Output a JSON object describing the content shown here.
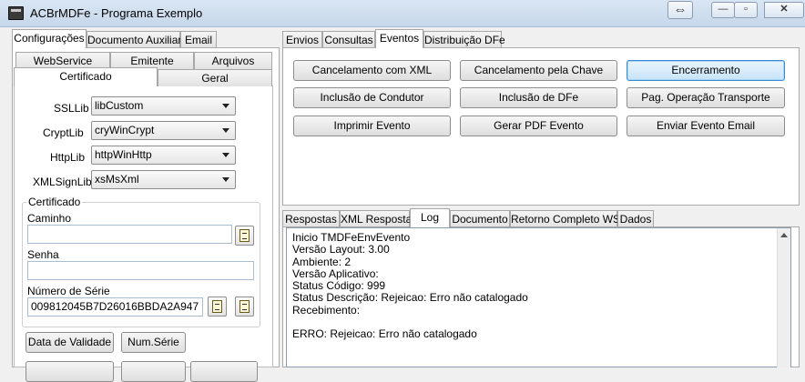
{
  "window": {
    "title": "ACBrMDFe - Programa Exemplo"
  },
  "left_tabs": [
    "Configurações",
    "Documento Auxiliar",
    "Email"
  ],
  "sub_tabs_row1": [
    "WebService",
    "Emitente",
    "Arquivos"
  ],
  "sub_tabs_row2": [
    "Certificado",
    "Geral"
  ],
  "libs": {
    "ssl_label": "SSLLib",
    "ssl_value": "libCustom",
    "crypt_label": "CryptLib",
    "crypt_value": "cryWinCrypt",
    "http_label": "HttpLib",
    "http_value": "httpWinHttp",
    "xmlsign_label": "XMLSignLib",
    "xmlsign_value": "xsMsXml"
  },
  "certificado": {
    "group_label": "Certificado",
    "caminho_label": "Caminho",
    "caminho_value": "",
    "senha_label": "Senha",
    "senha_value": "",
    "serie_label": "Número de Série",
    "serie_value": "009812045B7D26016BBDA2A947"
  },
  "cert_buttons": {
    "data_validade": "Data de Validade",
    "num_serie": "Num.Série"
  },
  "right_tabs": [
    "Envios",
    "Consultas",
    "Eventos",
    "Distribuição DFe"
  ],
  "event_buttons": [
    "Cancelamento com XML",
    "Cancelamento pela Chave",
    "Encerramento",
    "Inclusão de Condutor",
    "Inclusão de DFe",
    "Pag. Operação Transporte",
    "Imprimir Evento",
    "Gerar PDF Evento",
    "Enviar Evento Email"
  ],
  "result_tabs": [
    "Respostas",
    "XML Resposta",
    "Log",
    "Documento",
    "Retorno Completo WS",
    "Dados"
  ],
  "log_lines": [
    "Inicio TMDFeEnvEvento",
    "Versão Layout: 3.00",
    "Ambiente: 2",
    "Versão Aplicativo:",
    "Status Código: 999",
    "Status Descrição: Rejeicao: Erro não catalogado",
    "Recebimento:",
    "",
    "ERRO: Rejeicao: Erro não catalogado"
  ]
}
